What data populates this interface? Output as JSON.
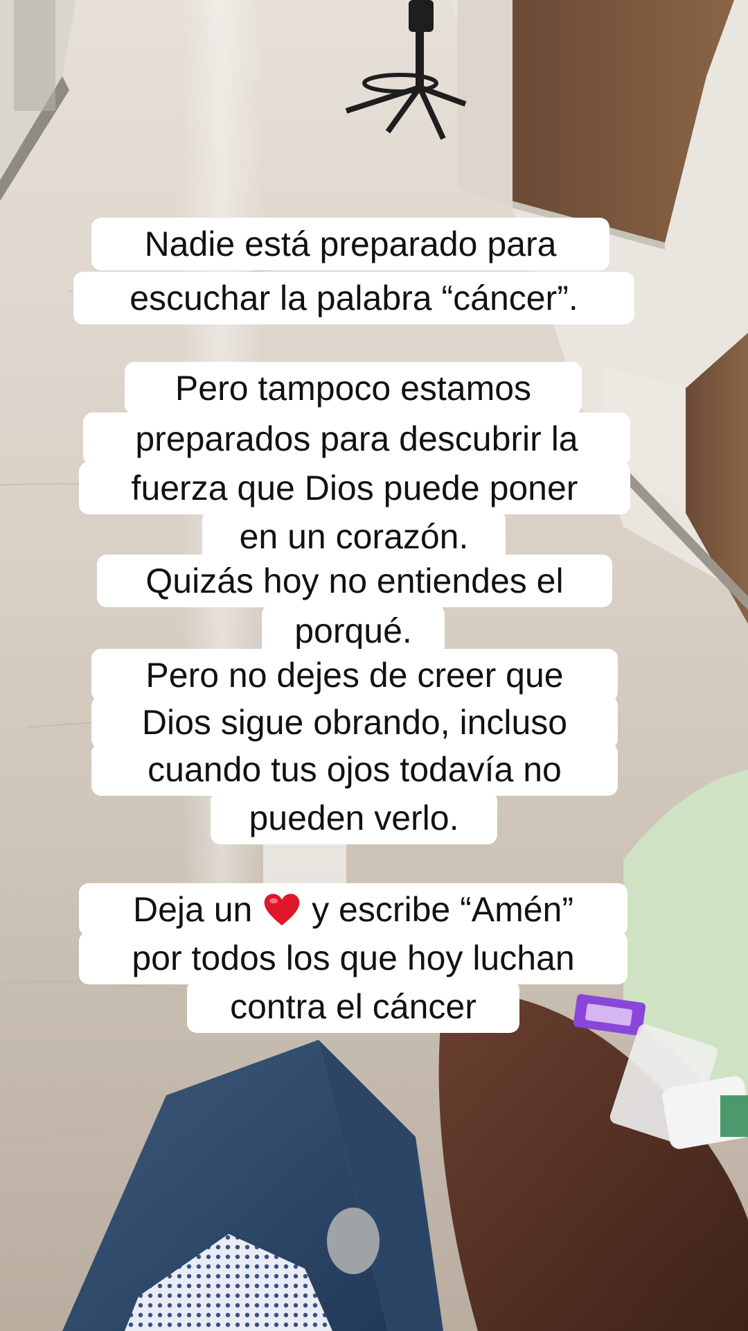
{
  "caption": {
    "paragraph_1": {
      "line_1": "Nadie está preparado para",
      "line_2": "escuchar la palabra “cáncer”."
    },
    "paragraph_2": {
      "line_1": "Pero tampoco estamos",
      "line_2": "preparados para descubrir la",
      "line_3": "fuerza que Dios puede poner",
      "line_4": "en un corazón.",
      "line_5": "Quizás hoy no entiendes el",
      "line_6": "porqué.",
      "line_7": "Pero no dejes de creer que",
      "line_8": "Dios sigue obrando, incluso",
      "line_9": "cuando tus ojos todavía no",
      "line_10": "pueden verlo."
    },
    "paragraph_3": {
      "line_1_before": "Deja un",
      "line_1_after": "y escribe “Amén”",
      "line_2": "por todos los que hoy luchan",
      "line_3": "contra el cáncer"
    },
    "heart_icon": "red-heart-emoji",
    "heart_color": "#e0162b"
  }
}
